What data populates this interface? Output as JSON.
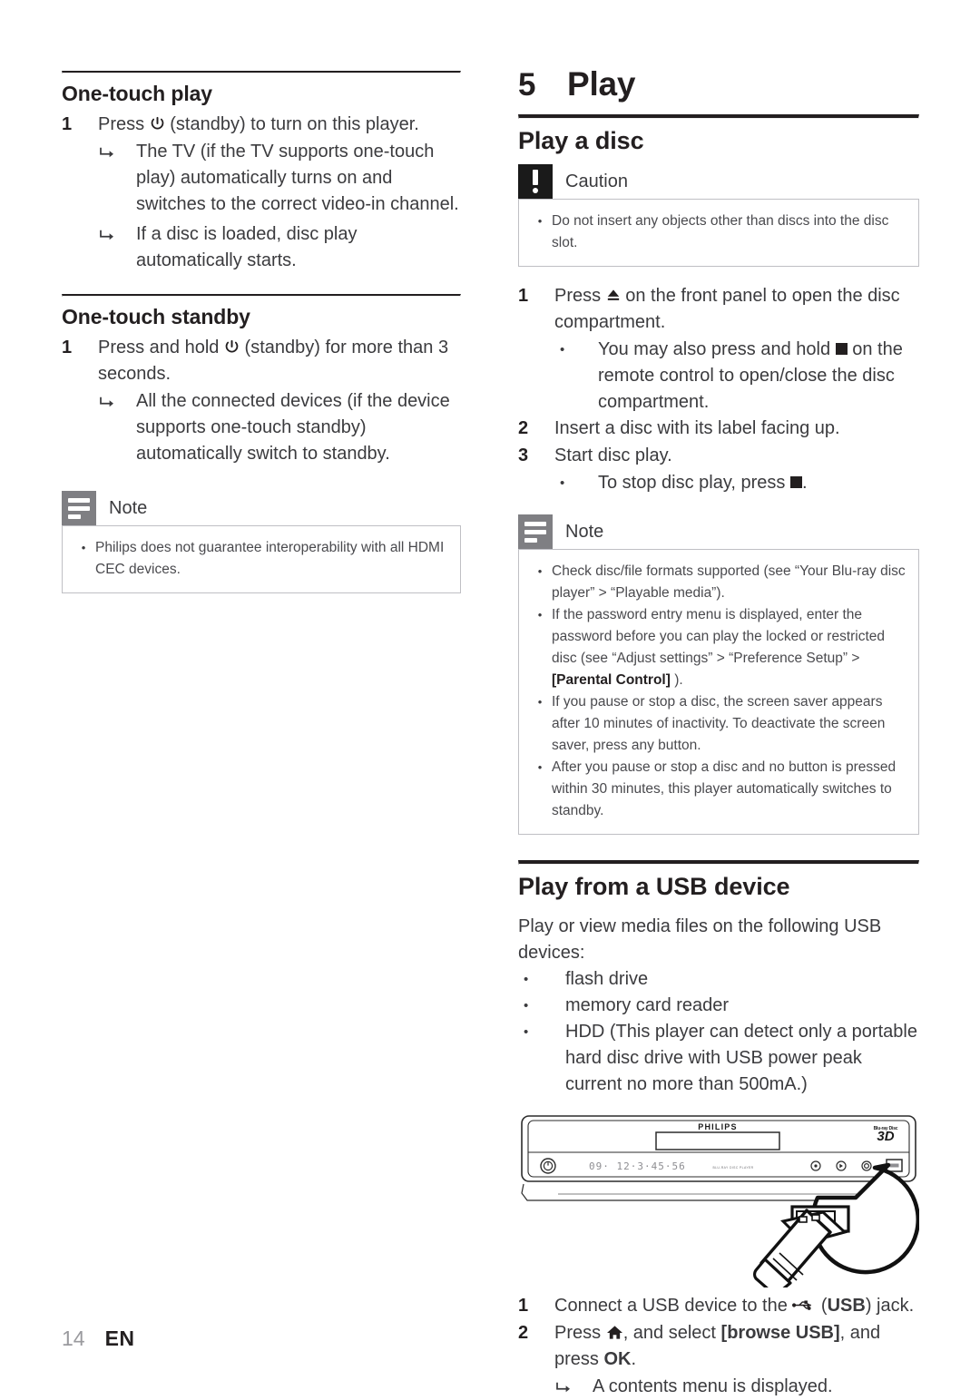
{
  "page": {
    "number": "14",
    "language": "EN"
  },
  "left_column": {
    "section_one": {
      "heading": "One-touch play",
      "steps": [
        {
          "num": "1",
          "text_before_icon": "Press ",
          "icon": "standby-power-icon",
          "text_after_icon": " (standby) to turn on this player.",
          "results": [
            "The TV (if the TV supports one-touch play) automatically turns on and switches to the correct video-in channel.",
            "If a disc is loaded, disc play automatically starts."
          ]
        }
      ]
    },
    "section_two": {
      "heading": "One-touch standby",
      "steps": [
        {
          "num": "1",
          "text_before_icon": "Press and hold ",
          "icon": "standby-power-icon",
          "text_after_icon": " (standby) for more than 3 seconds.",
          "results": [
            "All the connected devices (if the device supports one-touch standby) automatically switch to standby."
          ]
        }
      ]
    },
    "note": {
      "label": "Note",
      "icon": "note-lines-icon",
      "items": [
        "Philips does not guarantee interoperability with all HDMI CEC devices."
      ]
    }
  },
  "right_column": {
    "chapter": {
      "number": "5",
      "title": "Play"
    },
    "play_a_disc": {
      "heading": "Play a disc",
      "caution": {
        "label": "Caution",
        "icon": "caution-exclamation-icon",
        "items": [
          "Do not insert any objects other than discs into the disc slot."
        ]
      },
      "steps": [
        {
          "num": "1",
          "text_before_icon": "Press ",
          "icon": "eject-icon",
          "text_after_icon": " on the front panel to open the disc compartment.",
          "bullets": [
            {
              "before": "You may also press and hold ",
              "icon": "stop-square-icon",
              "after": " on the remote control to open/close the disc compartment."
            }
          ]
        },
        {
          "num": "2",
          "text": "Insert a disc with its label facing up.",
          "bullets": []
        },
        {
          "num": "3",
          "text": "Start disc play.",
          "bullets": [
            {
              "before": "To stop disc play, press ",
              "icon": "stop-square-icon",
              "after": "."
            }
          ]
        }
      ],
      "note": {
        "label": "Note",
        "icon": "note-lines-icon",
        "items": [
          {
            "parts": [
              {
                "type": "text",
                "value": "Check disc/file formats supported (see “Your Blu-ray disc player” > “Playable media”)."
              }
            ]
          },
          {
            "parts": [
              {
                "type": "text",
                "value": "If the password entry menu is displayed, enter the password before you can play the locked or restricted disc (see “Adjust settings” > “Preference Setup” > "
              },
              {
                "type": "bold",
                "value": "[Parental Control]"
              },
              {
                "type": "text",
                "value": " )."
              }
            ]
          },
          {
            "parts": [
              {
                "type": "text",
                "value": "If you pause or stop a disc, the screen saver appears after 10 minutes of inactivity. To deactivate the screen saver, press any button."
              }
            ]
          },
          {
            "parts": [
              {
                "type": "text",
                "value": "After you pause or stop a disc and no button is pressed within 30 minutes, this player automatically switches to standby."
              }
            ]
          }
        ]
      }
    },
    "play_from_usb": {
      "heading": "Play from a USB device",
      "intro": "Play or view media files on the following USB devices:",
      "bullets": [
        "flash drive",
        "memory card reader",
        "HDD (This player can detect only a portable hard disc drive with USB power peak current no more than 500mA.)"
      ],
      "illustration": {
        "name": "blu-ray-player-front-panel-usb-callout",
        "brand_logo": "PHILIPS",
        "format_logo_line1": "Blu-ray Disc",
        "format_logo_line2": "3D",
        "display_text": "09· 12·3·45·56",
        "panel_caption": "BLU-RAY DISC PLAYER",
        "callout": "usb-flash-drive-insert-magnifier"
      },
      "steps": [
        {
          "num": "1",
          "before": "Connect a USB device to the ",
          "icon": "usb-trident-icon",
          "mid": " (",
          "bold": "USB",
          "after": ") jack."
        },
        {
          "num": "2",
          "before": "Press ",
          "icon": "home-icon",
          "mid": ", and select ",
          "bold": "[browse USB]",
          "after": ", and press ",
          "bold2": "OK",
          "after2": ".",
          "results": [
            "A contents menu is displayed."
          ]
        }
      ]
    }
  },
  "colors": {
    "text": "#3b3b3e",
    "heading": "#231f20",
    "note_badge": "#7f7f83",
    "caution_badge": "#1a1a1a",
    "callout_border": "#bfbfc4",
    "page_number": "#9a9a9e"
  }
}
